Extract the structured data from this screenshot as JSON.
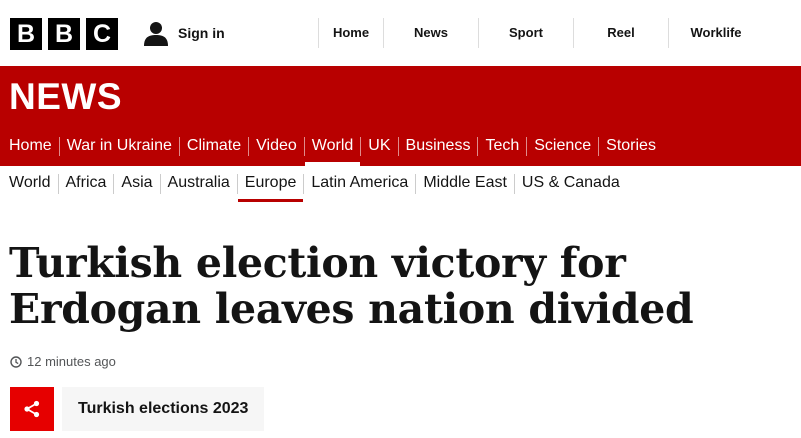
{
  "brand": {
    "letters": [
      "B",
      "B",
      "C"
    ]
  },
  "account": {
    "signin_label": "Sign in"
  },
  "top_nav": [
    "Home",
    "News",
    "Sport",
    "Reel",
    "Worklife"
  ],
  "section": {
    "wordmark": "NEWS",
    "color": "#b80000"
  },
  "main_nav": {
    "items": [
      "Home",
      "War in Ukraine",
      "Climate",
      "Video",
      "World",
      "UK",
      "Business",
      "Tech",
      "Science",
      "Stories"
    ],
    "active": "World"
  },
  "sub_nav": {
    "items": [
      "World",
      "Africa",
      "Asia",
      "Australia",
      "Europe",
      "Latin America",
      "Middle East",
      "US & Canada"
    ],
    "active": "Europe"
  },
  "article": {
    "headline": "Turkish election victory for Erdogan leaves nation divided",
    "timestamp": "12 minutes ago",
    "tag": "Turkish elections 2023"
  },
  "colors": {
    "share_button": "#e60000",
    "accent_red": "#b80000"
  }
}
